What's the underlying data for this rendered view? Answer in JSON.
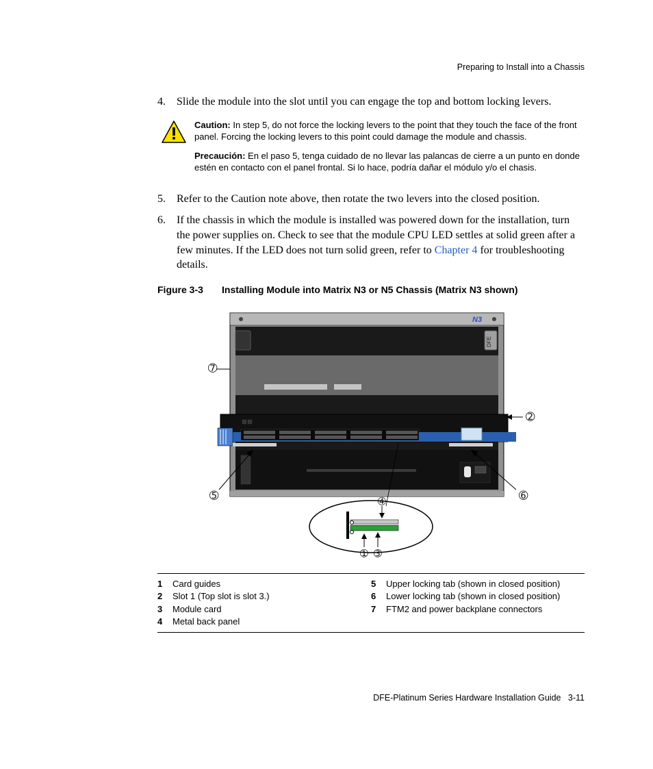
{
  "running_header": "Preparing to Install into a Chassis",
  "steps": {
    "s4_num": "4.",
    "s4_text": "Slide the module into the slot until you can engage the top and bottom locking levers.",
    "s5_num": "5.",
    "s5_text": "Refer to the Caution note above, then rotate the two levers into the closed position.",
    "s6_num": "6.",
    "s6_text_a": "If the chassis in which the module is installed was powered down for the installation, turn the power supplies on. Check to see that the module CPU LED settles at solid green after a few minutes. If the LED does not turn solid green, refer to ",
    "s6_link": "Chapter 4",
    "s6_text_b": " for troubleshooting details."
  },
  "caution": {
    "label_en": "Caution:",
    "text_en": " In step 5, do not force the locking levers to the point that they touch the face of the front panel. Forcing the locking levers to this point could damage the module and chassis.",
    "label_es": "Precaución:",
    "text_es": " En el paso 5, tenga cuidado de no llevar las palancas de cierre a un punto en donde estén en contacto con el panel frontal. Si lo hace, podría dañar el módulo y/o el chasis."
  },
  "figure": {
    "num": "Figure 3-3",
    "title": "Installing Module into Matrix N3 or N5 Chassis (Matrix N3 shown)",
    "product_label": "N3",
    "side_label": "DFE",
    "callouts": {
      "c1": "➀",
      "c2": "➁",
      "c3": "➂",
      "c4": "➃",
      "c5": "➄",
      "c6": "➅",
      "c7": "➆"
    }
  },
  "legend": {
    "l1_num": "1",
    "l1_text": "Card guides",
    "l2_num": "2",
    "l2_text": "Slot 1 (Top slot is slot 3.)",
    "l3_num": "3",
    "l3_text": "Module card",
    "l4_num": "4",
    "l4_text": "Metal back panel",
    "l5_num": "5",
    "l5_text": "Upper locking tab (shown in closed position)",
    "l6_num": "6",
    "l6_text": "Lower locking tab (shown in closed position)",
    "l7_num": "7",
    "l7_text": "FTM2 and power backplane connectors"
  },
  "running_footer_left": "DFE-Platinum Series Hardware Installation Guide",
  "running_footer_right": "3-11"
}
